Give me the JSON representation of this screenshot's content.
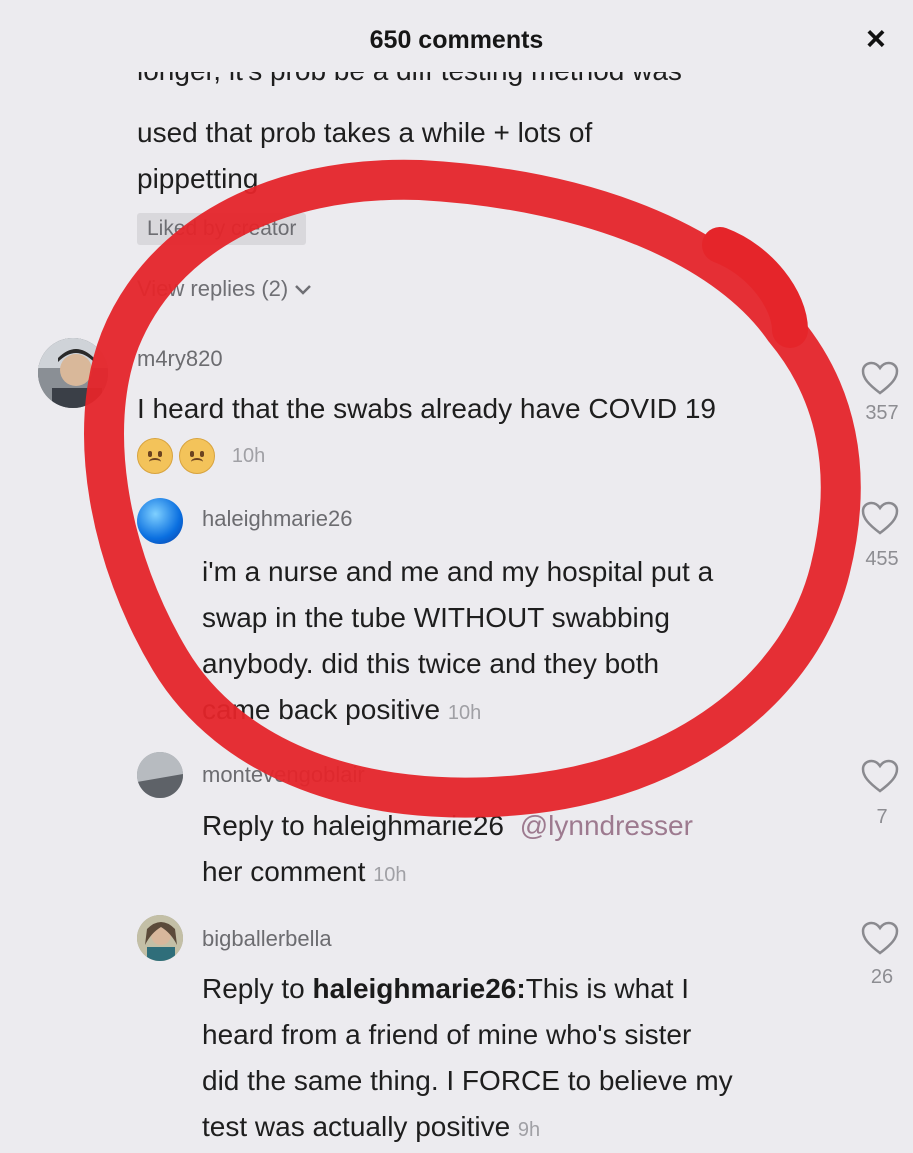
{
  "header": {
    "title": "650 comments",
    "close_label": "×"
  },
  "comment_prev": {
    "cut_line": "longer, it's prob be a diff testing method was",
    "line2": "used that prob takes a while + lots of",
    "line3": "pippetting",
    "creator_badge": "Liked by creator",
    "view_replies": "View replies (2)"
  },
  "comments": [
    {
      "username": "m4ry820",
      "text": "I heard that the swabs already have COVID 19",
      "time": "10h",
      "likes": "357"
    },
    {
      "username": "haleighmarie26",
      "lines": [
        "i'm a nurse and me and my hospital put a",
        "swap in the tube WITHOUT swabbing",
        "anybody. did this twice and they both",
        "came back positive"
      ],
      "time": "10h",
      "likes": "455"
    },
    {
      "username": "montevengoblair",
      "reply_prefix": "Reply to haleighmarie26",
      "mention": "@lynndresser",
      "line2": "her comment",
      "time": "10h",
      "likes": "7"
    },
    {
      "username": "bigballerbella",
      "reply_prefix": "Reply to ",
      "reply_target": "haleighmarie26:",
      "line1_rest": "This is what I",
      "lines": [
        "heard from a friend of mine who's sister",
        "did the same thing. I FORCE to believe my",
        "test was actually positive"
      ],
      "time": "9h",
      "likes": "26"
    }
  ],
  "colors": {
    "annotation_circle": "#e5252a",
    "background": "#ecebef"
  }
}
